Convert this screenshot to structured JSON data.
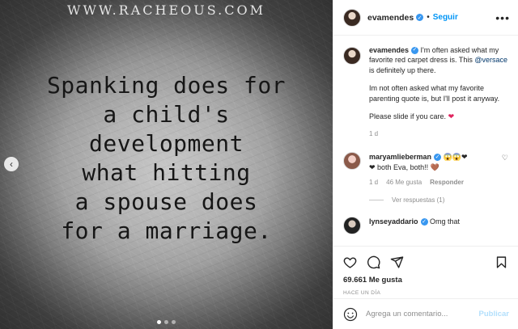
{
  "media": {
    "watermark": "WWW.RACHEOUS.COM",
    "quote_lines": [
      "Spanking does for",
      "a child's",
      "development",
      "what hitting",
      "a spouse does",
      "for a marriage."
    ],
    "carousel_total": 3,
    "carousel_active": 1
  },
  "post": {
    "author": "evamendes",
    "follow_label": "Seguir",
    "more_label": "•••",
    "caption": {
      "username": "evamendes",
      "line1_pre": "I'm often asked what my favorite red carpet dress is. This ",
      "mention": "@versace",
      "line1_post": " is definitely up there.",
      "paragraph2": "Im not often asked what my favorite parenting quote is, but I'll post it anyway.",
      "paragraph3": "Please slide if you care.",
      "paragraph3_emoji": "❤",
      "time": "1 d"
    },
    "comments": [
      {
        "username": "maryamlieberman",
        "emojis": "😱😱❤",
        "text": "❤ both Eva, both!! 🤎",
        "time": "1 d",
        "likes": "46 Me gusta",
        "reply_label": "Responder",
        "view_replies": "Ver respuestas (1)"
      },
      {
        "username": "lynseyaddario",
        "text": "Omg that"
      }
    ],
    "likes_count": "69.661 Me gusta",
    "time_ago": "HACE UN DÍA",
    "comment_placeholder": "Agrega un comentario...",
    "publish_label": "Publicar"
  },
  "colors": {
    "accent_blue": "#0095f6",
    "publish_disabled": "#b2dffc",
    "verified_blue": "#3897f0"
  }
}
